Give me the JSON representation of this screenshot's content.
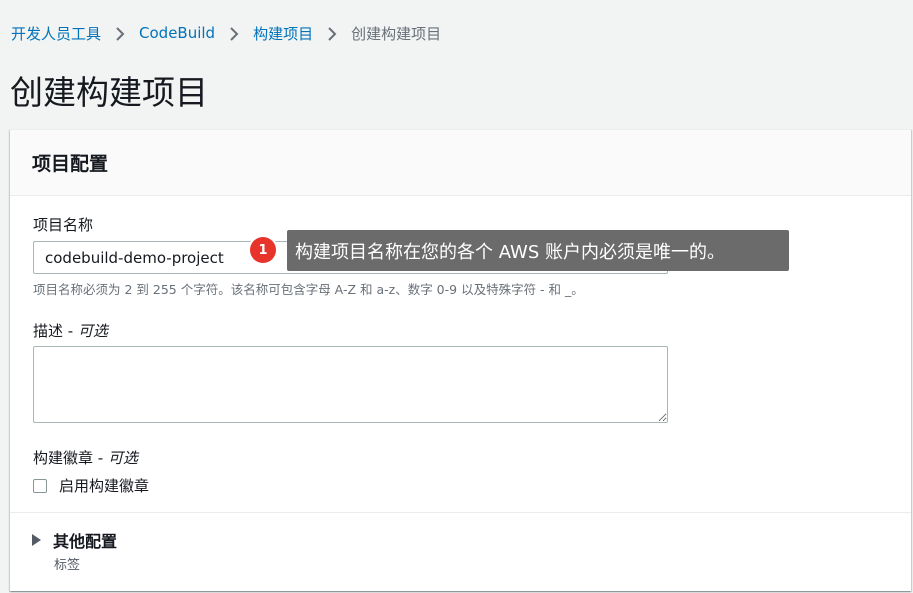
{
  "breadcrumb": {
    "items": [
      "开发人员工具",
      "CodeBuild",
      "构建项目"
    ],
    "current": "创建构建项目"
  },
  "page": {
    "title": "创建构建项目"
  },
  "panel": {
    "title": "项目配置",
    "project_name": {
      "label": "项目名称",
      "value": "codebuild-demo-project",
      "hint": "项目名称必须为 2 到 255 个字符。该名称可包含字母 A-Z 和 a-z、数字 0-9 以及特殊字符 - 和 _。"
    },
    "description": {
      "label": "描述",
      "optional": "可选",
      "value": ""
    },
    "badge": {
      "label": "构建徽章",
      "optional": "可选",
      "checkbox_label": "启用构建徽章",
      "checked": false
    },
    "additional": {
      "title": "其他配置",
      "subtitle": "标签"
    }
  },
  "callout": {
    "number": "1",
    "text": "构建项目名称在您的各个 AWS 账户内必须是唯一的。"
  },
  "colors": {
    "link": "#0073bb",
    "callout_badge": "#e8332a",
    "tooltip_bg": "#6b6b6b"
  }
}
